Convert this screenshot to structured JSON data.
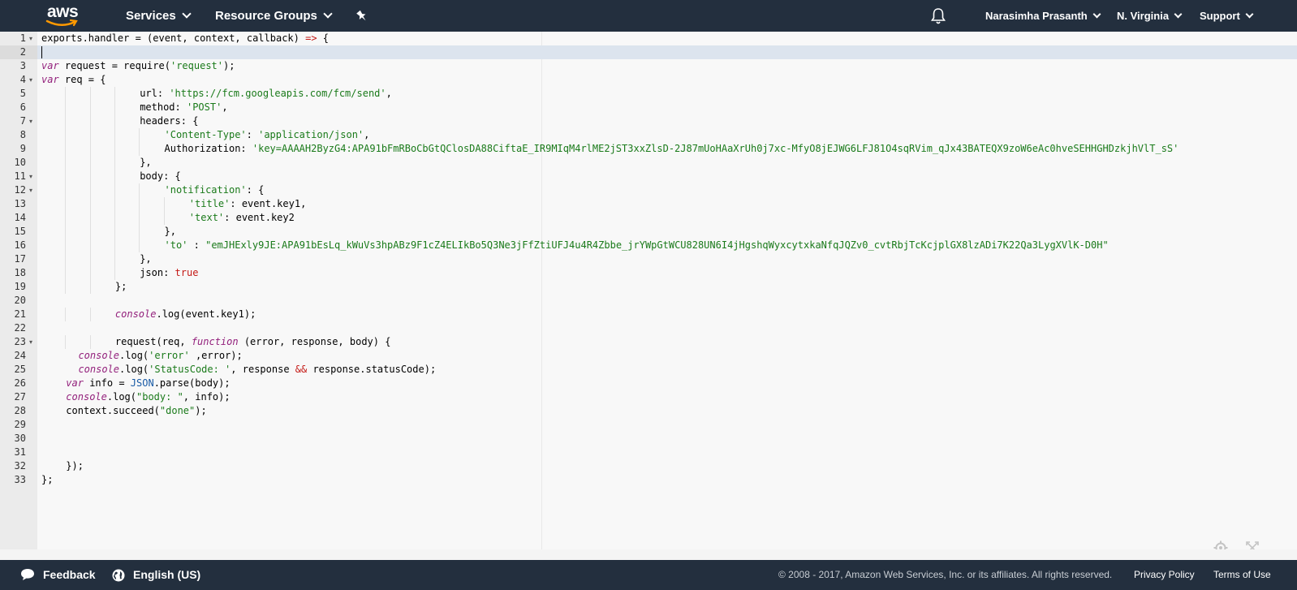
{
  "header": {
    "logo_text": "aws",
    "services_label": "Services",
    "resource_groups_label": "Resource Groups",
    "pin_icon": "pin-icon",
    "bell_icon": "bell-icon",
    "user_label": "Narasimha Prasanth",
    "region_label": "N. Virginia",
    "support_label": "Support"
  },
  "editor": {
    "lines": [
      {
        "n": "1",
        "fold": true,
        "indent": 0,
        "text": "exports.handler = (event, context, callback) => {"
      },
      {
        "n": "2",
        "fold": false,
        "indent": 0,
        "text": ""
      },
      {
        "n": "3",
        "fold": false,
        "indent": 0,
        "text": "var request = require('request');"
      },
      {
        "n": "4",
        "fold": true,
        "indent": 0,
        "text": "var req = {"
      },
      {
        "n": "5",
        "fold": false,
        "indent": 4,
        "text": "url: 'https://fcm.googleapis.com/fcm/send',"
      },
      {
        "n": "6",
        "fold": false,
        "indent": 4,
        "text": "method: 'POST',"
      },
      {
        "n": "7",
        "fold": true,
        "indent": 4,
        "text": "headers: {"
      },
      {
        "n": "8",
        "fold": false,
        "indent": 5,
        "text": "'Content-Type': 'application/json',"
      },
      {
        "n": "9",
        "fold": false,
        "indent": 5,
        "text": "Authorization: 'key=AAAAH2ByzG4:APA91bFmRBoCbGtQClosDA88CiftaE_IR9MIqM4rlME2jST3xxZlsD-2J87mUoHAaXrUh0j7xc-MfyO8jEJWG6LFJ81O4sqRVim_qJx43BATEQX9zoW6eAc0hveSEHHGHDzkjhVlT_sS'"
      },
      {
        "n": "10",
        "fold": false,
        "indent": 4,
        "text": "},"
      },
      {
        "n": "11",
        "fold": true,
        "indent": 4,
        "text": "body: {"
      },
      {
        "n": "12",
        "fold": true,
        "indent": 5,
        "text": "'notification': {"
      },
      {
        "n": "13",
        "fold": false,
        "indent": 6,
        "text": "'title': event.key1,"
      },
      {
        "n": "14",
        "fold": false,
        "indent": 6,
        "text": "'text': event.key2"
      },
      {
        "n": "15",
        "fold": false,
        "indent": 5,
        "text": "},"
      },
      {
        "n": "16",
        "fold": false,
        "indent": 5,
        "text": "'to' : \"emJHExly9JE:APA91bEsLq_kWuVs3hpABz9F1cZ4ELIkBo5Q3Ne3jFfZtiUFJ4u4R4Zbbe_jrYWpGtWCU828UN6I4jHgshqWyxcytxkaNfqJQZv0_cvtRbjTcKcjplGX8lzADi7K22Qa3LygXVlK-D0H\""
      },
      {
        "n": "17",
        "fold": false,
        "indent": 4,
        "text": "},"
      },
      {
        "n": "18",
        "fold": false,
        "indent": 4,
        "text": "json: true"
      },
      {
        "n": "19",
        "fold": false,
        "indent": 3,
        "text": "};"
      },
      {
        "n": "20",
        "fold": false,
        "indent": 0,
        "text": ""
      },
      {
        "n": "21",
        "fold": false,
        "indent": 3,
        "text": "console.log(event.key1);"
      },
      {
        "n": "22",
        "fold": false,
        "indent": 0,
        "text": ""
      },
      {
        "n": "23",
        "fold": true,
        "indent": 3,
        "text": "request(req, function (error, response, body) {"
      },
      {
        "n": "24",
        "fold": false,
        "indent": 1.5,
        "text": "console.log('error' ,error);"
      },
      {
        "n": "25",
        "fold": false,
        "indent": 1.5,
        "text": "console.log('StatusCode: ', response && response.statusCode);"
      },
      {
        "n": "26",
        "fold": false,
        "indent": 1,
        "text": "var info = JSON.parse(body);"
      },
      {
        "n": "27",
        "fold": false,
        "indent": 1,
        "text": "console.log(\"body: \", info);"
      },
      {
        "n": "28",
        "fold": false,
        "indent": 1,
        "text": "context.succeed(\"done\");"
      },
      {
        "n": "29",
        "fold": false,
        "indent": 0,
        "text": ""
      },
      {
        "n": "30",
        "fold": false,
        "indent": 0,
        "text": ""
      },
      {
        "n": "31",
        "fold": false,
        "indent": 0,
        "text": ""
      },
      {
        "n": "32",
        "fold": false,
        "indent": 1,
        "text": "});"
      },
      {
        "n": "33",
        "fold": false,
        "indent": 0,
        "text": "};"
      }
    ],
    "settings_icon": "gear-icon",
    "fullscreen_icon": "expand-icon"
  },
  "footer": {
    "feedback_label": "Feedback",
    "language_label": "English (US)",
    "copyright": "© 2008 - 2017, Amazon Web Services, Inc. or its affiliates. All rights reserved.",
    "privacy_label": "Privacy Policy",
    "terms_label": "Terms of Use"
  }
}
